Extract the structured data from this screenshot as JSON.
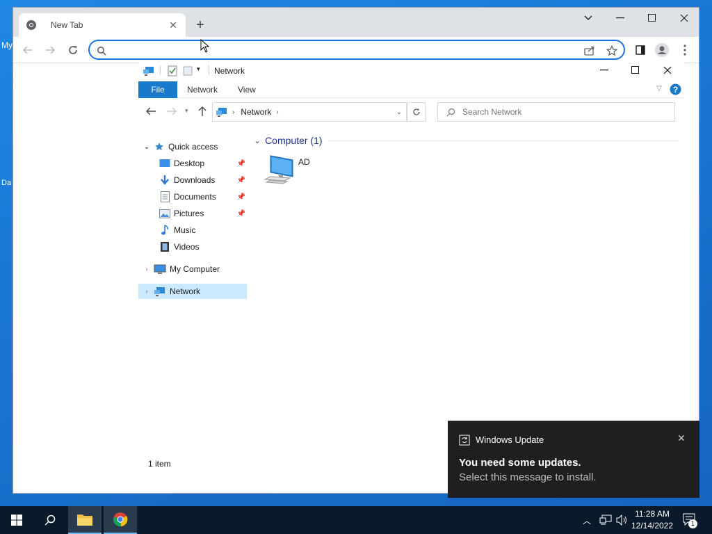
{
  "desktop": {
    "label1": "My",
    "label2": "Da"
  },
  "browser": {
    "tab_title": "New Tab",
    "omnibox_value": "",
    "omnibox_placeholder": ""
  },
  "explorer": {
    "title": "Network",
    "ribbon_tabs": [
      "File",
      "Network",
      "View"
    ],
    "address_location": "Network",
    "search_placeholder": "Search Network",
    "nav": {
      "quick_access": "Quick access",
      "items": [
        "Desktop",
        "Downloads",
        "Documents",
        "Pictures",
        "Music",
        "Videos"
      ],
      "my_computer": "My Computer",
      "network": "Network"
    },
    "group_header": "Computer (1)",
    "computer_item": "AD",
    "status": "1 item"
  },
  "toast": {
    "app": "Windows Update",
    "title": "You need some updates.",
    "body": "Select this message to install."
  },
  "taskbar": {
    "time": "11:28 AM",
    "date": "12/14/2022",
    "notification_count": "1"
  },
  "colors": {
    "accent": "#1a73e8",
    "file_tab": "#1979ca",
    "selected": "#cce8ff",
    "toast_bg": "#1f1f1f"
  }
}
